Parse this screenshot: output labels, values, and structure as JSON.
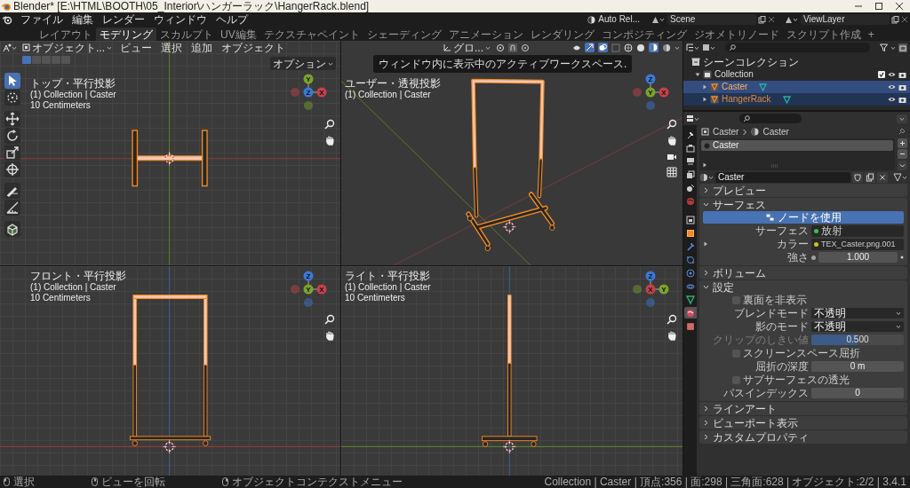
{
  "title_bar": {
    "title": "Blender* [E:\\HTML\\BOOTH\\05_Interior\\ハンガーラック\\HangerRack.blend]"
  },
  "menu": [
    "ファイル",
    "編集",
    "レンダー",
    "ウィンドウ",
    "ヘルプ"
  ],
  "workspaces": [
    {
      "label": "レイアウト",
      "selected": false
    },
    {
      "label": "モデリング",
      "selected": true
    },
    {
      "label": "スカルプト",
      "selected": false
    },
    {
      "label": "UV編集",
      "selected": false
    },
    {
      "label": "テクスチャペイント",
      "selected": false
    },
    {
      "label": "シェーディング",
      "selected": false
    },
    {
      "label": "アニメーション",
      "selected": false
    },
    {
      "label": "レンダリング",
      "selected": false
    },
    {
      "label": "コンポジティング",
      "selected": false
    },
    {
      "label": "ジオメトリノード",
      "selected": false
    },
    {
      "label": "スクリプト作成",
      "selected": false
    }
  ],
  "add_workspace": "+",
  "scene_bar": {
    "render_engine": "Auto Rel...",
    "scene": "Scene",
    "view_layer": "ViewLayer"
  },
  "viewport_header": {
    "mode": "オブジェクト...",
    "menus": [
      "ビュー",
      "選択",
      "追加",
      "オブジェクト"
    ],
    "orientation": "グロ...",
    "options": "オプション"
  },
  "select_modes": [
    {
      "selected": true
    },
    {
      "selected": false
    },
    {
      "selected": false
    },
    {
      "selected": false
    },
    {
      "selected": false
    }
  ],
  "tools": [
    {
      "selected": true
    },
    {
      "selected": false
    },
    {
      "selected": false
    },
    {
      "selected": false
    },
    {
      "selected": false
    },
    {
      "selected": false
    },
    {
      "selected": false
    },
    {
      "selected": false
    },
    {
      "selected": false
    }
  ],
  "tooltip": "ウィンドウ内に表示中のアクティブワークスペース.",
  "viewports": [
    {
      "kind": "top",
      "title": "トップ・平行投影",
      "info": "(1) Collection | Caster",
      "scale": "10 Centimeters",
      "gizmo": [
        {
          "label": "Y",
          "color": "#7ca32a"
        },
        {
          "label": "Z",
          "color": "#3b7ad6"
        },
        {
          "label": "X",
          "color": "#c8404a"
        }
      ]
    },
    {
      "kind": "perspective",
      "title": "ユーザー・透視投影",
      "info": "(1) Collection | Caster",
      "gizmo": [
        {
          "label": "Z",
          "color": "#3b7ad6"
        },
        {
          "label": "Y",
          "color": "#7ca32a"
        },
        {
          "label": "X",
          "color": "#c8404a"
        }
      ]
    },
    {
      "kind": "front",
      "title": "フロント・平行投影",
      "info": "(1) Collection | Caster",
      "scale": "10 Centimeters",
      "gizmo": [
        {
          "label": "Z",
          "color": "#3b7ad6"
        },
        {
          "label": "Y",
          "color": "#7ca32a"
        },
        {
          "label": "X",
          "color": "#c8404a"
        }
      ]
    },
    {
      "kind": "right",
      "title": "ライト・平行投影",
      "info": "(1) Collection | Caster",
      "scale": "10 Centimeters",
      "gizmo": [
        {
          "label": "Z",
          "color": "#3b7ad6"
        },
        {
          "label": "X",
          "color": "#c8404a"
        },
        {
          "label": "Y",
          "color": "#7ca32a"
        }
      ]
    }
  ],
  "outliner": {
    "tree": [
      {
        "label": "シーンコレクション",
        "kind": "scene",
        "selected": false,
        "children": [
          {
            "label": "Collection",
            "kind": "collection",
            "selected": false,
            "expanded": true,
            "checked": true,
            "children": [
              {
                "label": "Caster",
                "kind": "object",
                "selected": true,
                "active": true,
                "expanded": false
              },
              {
                "label": "HangerRack",
                "kind": "object",
                "selected": true,
                "active": false,
                "expanded": false
              }
            ]
          }
        ]
      }
    ]
  },
  "properties": {
    "tabs": [
      {
        "selected": false
      },
      {
        "selected": false
      },
      {
        "selected": false
      },
      {
        "selected": false
      },
      {
        "selected": false
      },
      {
        "selected": false
      },
      {
        "selected": false
      },
      {
        "selected": false
      },
      {
        "selected": false
      },
      {
        "selected": false
      },
      {
        "selected": false
      },
      {
        "selected": false
      },
      {
        "selected": false
      },
      {
        "selected": true
      },
      {
        "selected": false
      }
    ],
    "breadcrumb": [
      "Caster",
      "Caster"
    ],
    "slots": [
      {
        "name": "Caster",
        "selected": true
      }
    ],
    "material_name": "Caster",
    "panels": [
      {
        "title": "プレビュー",
        "expanded": false
      },
      {
        "title": "サーフェス",
        "expanded": true,
        "rows": [
          {
            "kind": "button",
            "label": "ノードを使用"
          },
          {
            "kind": "link",
            "label": "サーフェス",
            "value": "放射",
            "color": "#3fbf4f"
          },
          {
            "kind": "link",
            "label": "カラー",
            "value": "TEX_Caster.png.001",
            "color": "#c8c029",
            "expandable": true
          },
          {
            "kind": "number",
            "label": "強さ",
            "value": "1.000",
            "color": "#a1a1a1"
          }
        ]
      },
      {
        "title": "ボリューム",
        "expanded": false
      },
      {
        "title": "設定",
        "expanded": true,
        "rows": [
          {
            "kind": "checkbox",
            "label": "裏面を非表示",
            "checked": false
          },
          {
            "kind": "dropdown",
            "label": "ブレンドモード",
            "value": "不透明"
          },
          {
            "kind": "dropdown",
            "label": "影のモード",
            "value": "不透明"
          },
          {
            "kind": "slider",
            "label": "クリップのしきい値",
            "value": "0.500",
            "level": 0.5,
            "disabled": true
          },
          {
            "kind": "checkbox",
            "label": "スクリーンスペース屈折",
            "checked": false
          },
          {
            "kind": "number",
            "label": "屈折の深度",
            "value": "0 m"
          },
          {
            "kind": "checkbox",
            "label": "サブサーフェスの透光",
            "checked": false
          },
          {
            "kind": "number",
            "label": "パスインデックス",
            "value": "0"
          }
        ]
      },
      {
        "title": "ラインアート",
        "expanded": false
      },
      {
        "title": "ビューポート表示",
        "expanded": false
      },
      {
        "title": "カスタムプロパティ",
        "expanded": false
      }
    ]
  },
  "status_bar": {
    "hints": [
      "選択",
      "ビューを回転",
      "オブジェクトコンテクストメニュー"
    ],
    "stats": "Collection | Caster | 頂点:356 | 面:298 | 三角面:628 | オブジェクト:2/2 | 3.4.1"
  }
}
